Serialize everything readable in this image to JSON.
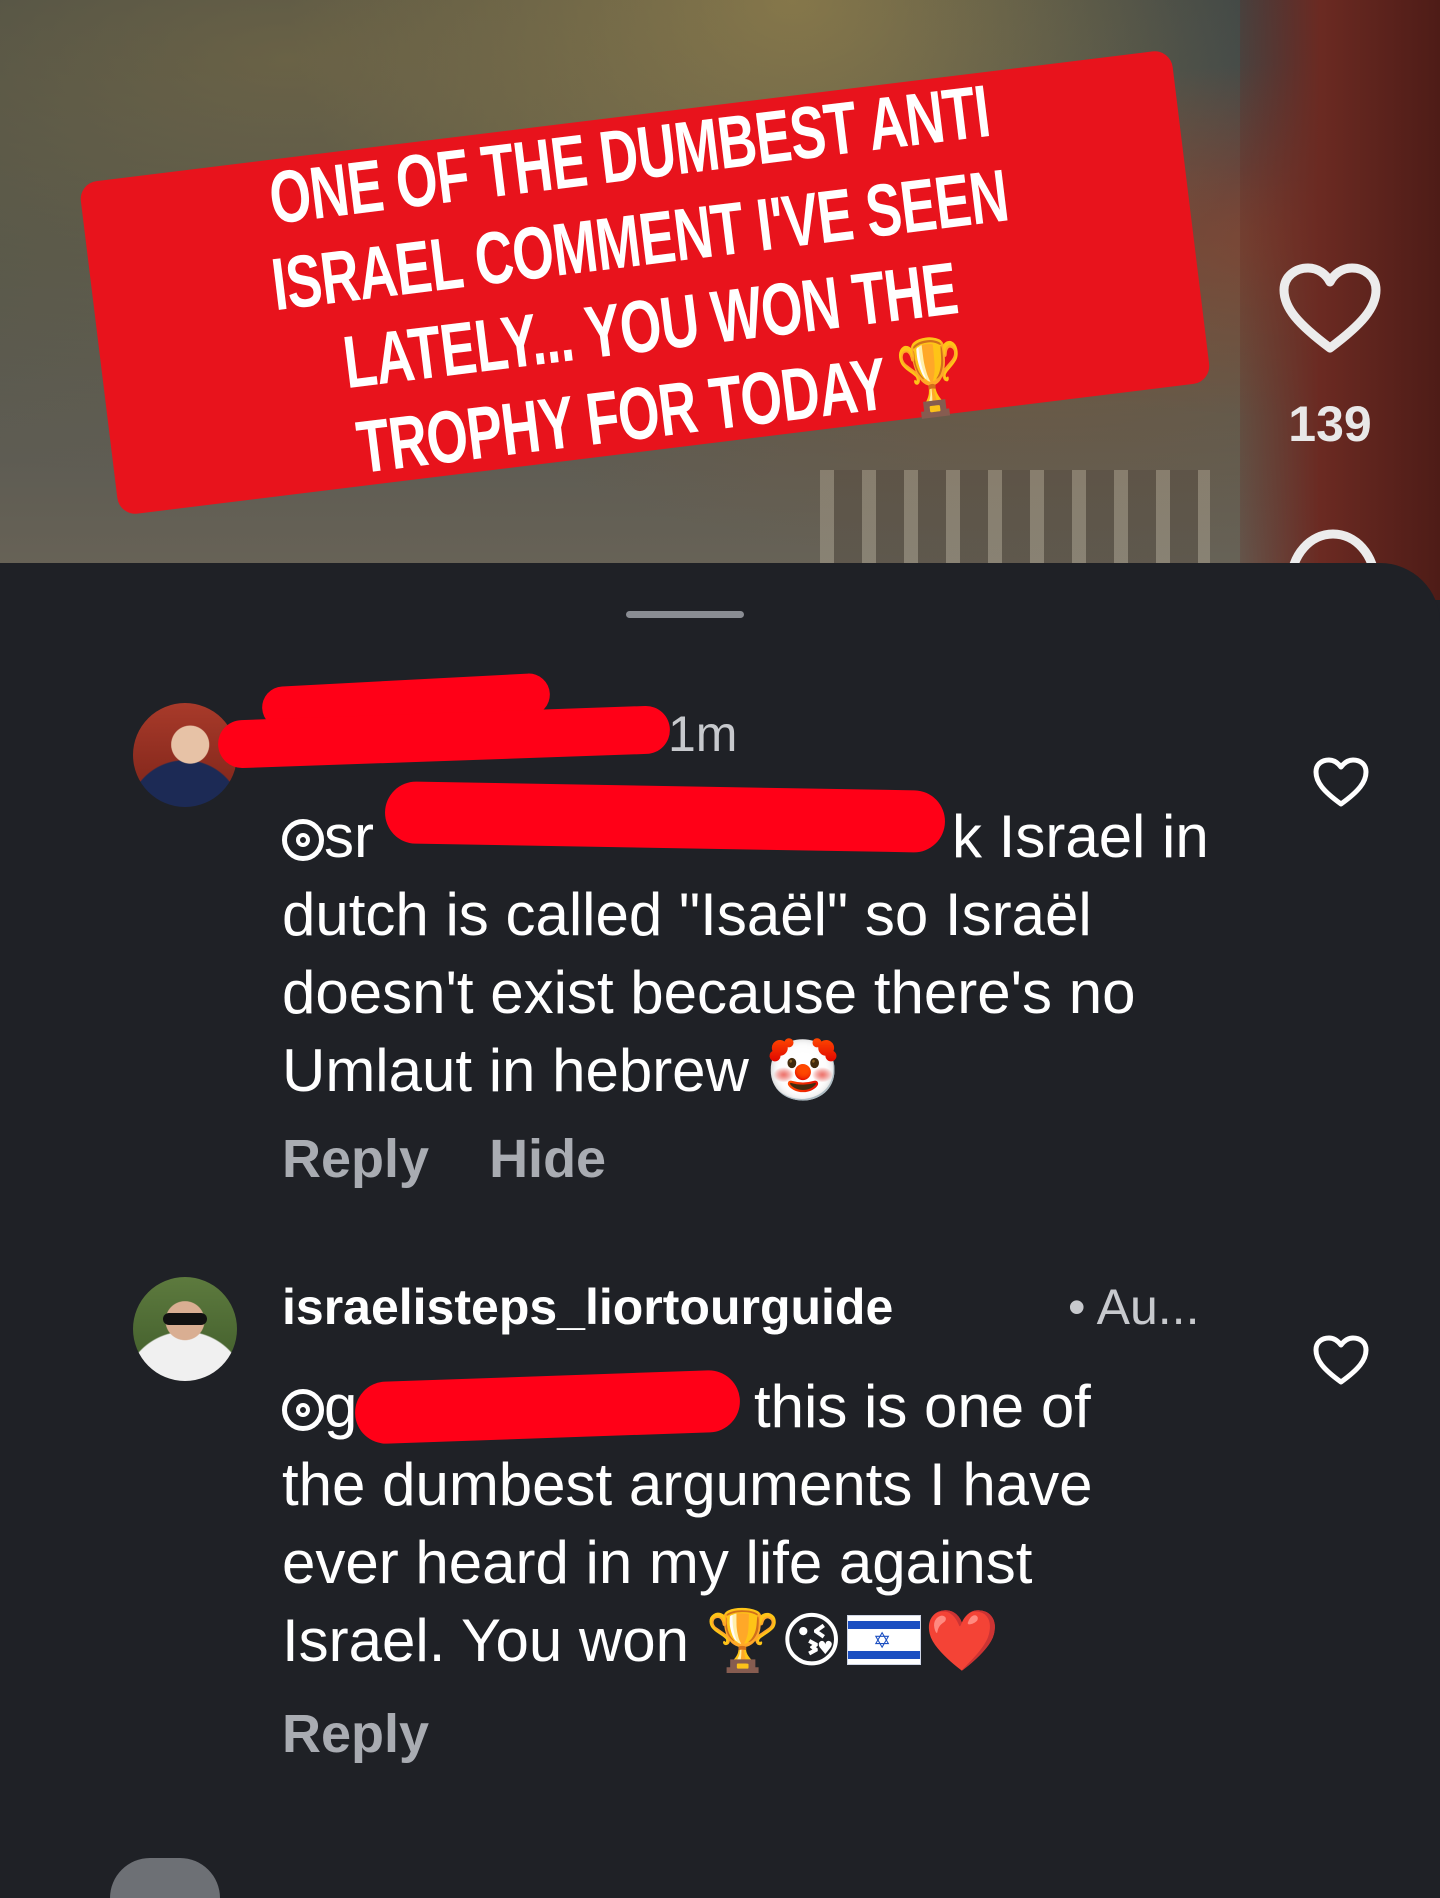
{
  "video": {
    "caption": "ONE OF THE DUMBEST ANTI ISRAEL COMMENT I'VE SEEN LATELY... YOU WON THE TROPHY FOR TODAY 🏆",
    "like_count": "139",
    "caption_color": "#e8131c"
  },
  "comments": [
    {
      "time": "1m",
      "mention_prefix": "sr",
      "body_fragment": "k Israel in",
      "body_rest": "dutch is called \"Isaël\" so Israël doesn't exist because there's no Umlaut in hebrew 🤡",
      "actions": [
        "Reply",
        "Hide"
      ]
    },
    {
      "username": "israelisteps_liortourguide",
      "time": "• Au...",
      "mention_prefix": "g",
      "body_fragment": "this is one of",
      "body_rest_1": "the dumbest arguments I have",
      "body_rest_2": "ever heard in my life against",
      "body_rest_3": "Israel. You won",
      "body_emojis": "🏆😘",
      "body_emoji_end": "❤️",
      "actions": [
        "Reply"
      ]
    }
  ],
  "icons": {
    "side_like": "heart-outline-icon",
    "side_comment": "comment-bubble-icon",
    "comment_like": "heart-outline-icon",
    "mention": "threads-mention-icon"
  },
  "colors": {
    "sheet_bg": "#1f2126",
    "redaction": "#ff0017",
    "secondary_text": "#a9acb2"
  }
}
